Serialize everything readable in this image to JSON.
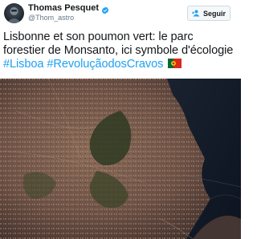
{
  "tweet": {
    "author": {
      "display_name": "Thomas Pesquet",
      "handle": "@Thom_astro",
      "verified": true
    },
    "follow_button": {
      "label": "Seguir",
      "icon": "add-person-icon"
    },
    "text": {
      "line1": "Lisbonne et son poumon vert: le parc",
      "line2": "forestier de Monsanto, ici symbole d'écologie",
      "hashtags": [
        "#Lisboa",
        "#RevoluçãodosCravos"
      ],
      "emoji": "portugal-flag"
    },
    "photo": {
      "subject": "satellite-photo-lisbon"
    }
  },
  "colors": {
    "link": "#1da1f2",
    "verified": "#1da1f2",
    "text": "#14171a",
    "handle": "#657786"
  }
}
